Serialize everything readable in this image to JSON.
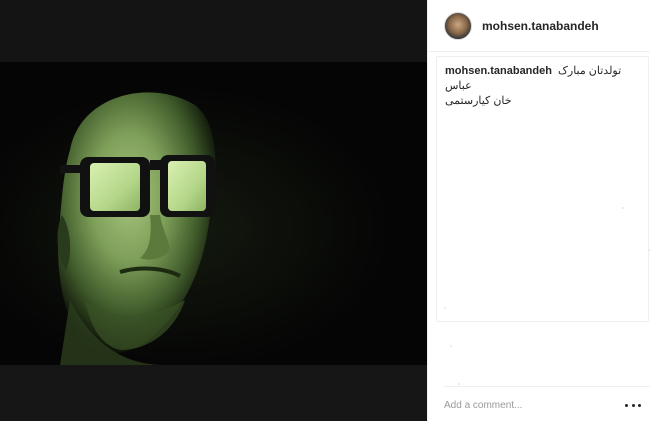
{
  "post": {
    "author": {
      "username": "mohsen.tanabandeh",
      "avatar_icon": "profile-avatar"
    },
    "caption": {
      "username": "mohsen.tanabandeh",
      "line1": "تولدتان مبارک عباس",
      "line2": "خان کیارستمی"
    },
    "media": {
      "tint_color": "#7fa05a",
      "background_color": "#121212"
    },
    "comment": {
      "placeholder": "Add a comment...",
      "more_icon": "more-options-ellipsis-icon"
    }
  }
}
